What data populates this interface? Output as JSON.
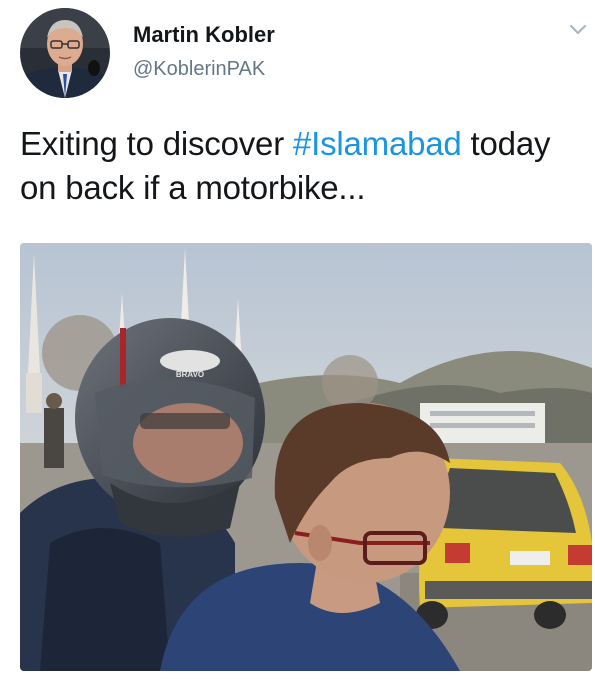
{
  "user": {
    "display_name": "Martin Kobler",
    "handle": "@KoblerinPAK"
  },
  "tweet": {
    "text_before": "Exiting to discover ",
    "hashtag": "#Islamabad",
    "text_after": " today on back if a motorbike..."
  },
  "helmet_brand": "BRAVO",
  "icons": {
    "menu": "chevron-down-icon"
  },
  "colors": {
    "link": "#1b95e0",
    "text": "#14171a",
    "secondary_text": "#657786"
  }
}
